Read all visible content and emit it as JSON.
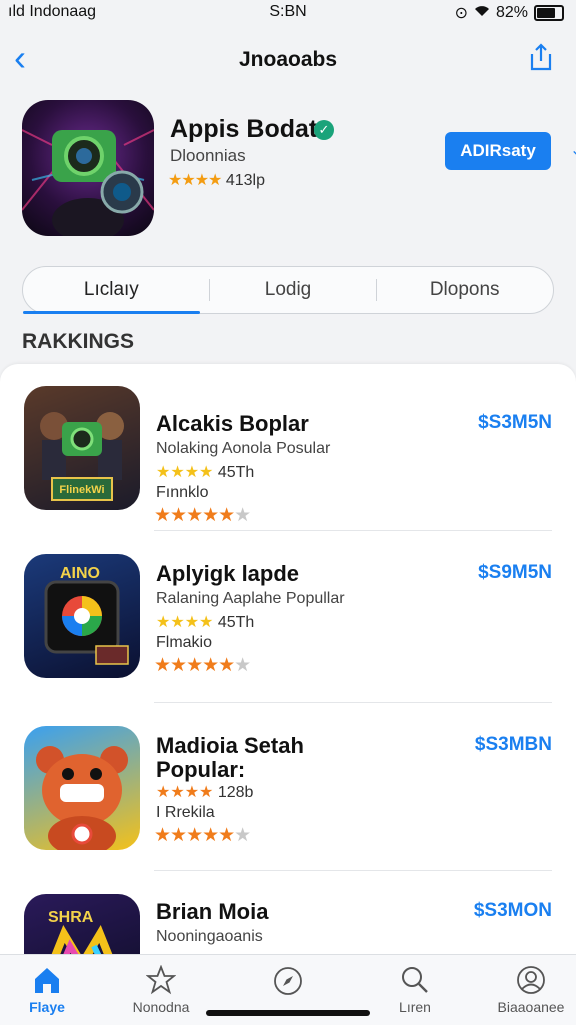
{
  "status": {
    "carrier": "ıld Indonaag",
    "time": "S:BN",
    "battery": "82%",
    "battery_level": 0.82
  },
  "nav": {
    "title": "Jnoaoabs"
  },
  "app": {
    "name": "Appis Bodat",
    "developer": "Dloonnias",
    "rating": "413lp",
    "get_label": "ADIRsaty"
  },
  "segments": [
    "Lıclaıy",
    "Lodig",
    "Dlopons"
  ],
  "section_title": "RAKKINGS",
  "rows": [
    {
      "name": "Alcakis Boplar",
      "subtitle": "Nolaking Aonola Posular",
      "rating": "45Th",
      "category": "Fınnklo",
      "price": "$S3M5N",
      "stars": 4
    },
    {
      "name": "Aplyigk lapde",
      "subtitle": "Ralaning Aaplahe Popullar",
      "rating": "45Th",
      "category": "Flmakio",
      "price": "$S9M5N",
      "stars": 4
    },
    {
      "name": "Madioia Setah Popular:",
      "subtitle": "",
      "rating": "128b",
      "category": "I Rrekila",
      "price": "$S3MBN",
      "stars": 4
    },
    {
      "name": "Brian Moia",
      "subtitle": "Nooningaoanis",
      "rating": "",
      "category": "",
      "price": "$S3MON",
      "stars": 0
    }
  ],
  "tabs": [
    {
      "label": "Flaye",
      "icon": "house-icon",
      "active": true
    },
    {
      "label": "Nonodna",
      "icon": "star-icon",
      "active": false
    },
    {
      "label": "",
      "icon": "compass-icon",
      "active": false
    },
    {
      "label": "Lıren",
      "icon": "search-icon",
      "active": false
    },
    {
      "label": "Biaaoanee",
      "icon": "person-icon",
      "active": false
    }
  ],
  "colors": {
    "accent": "#1a7ff0",
    "star_yellow": "#f4c11a",
    "star_orange": "#f07c1b"
  }
}
